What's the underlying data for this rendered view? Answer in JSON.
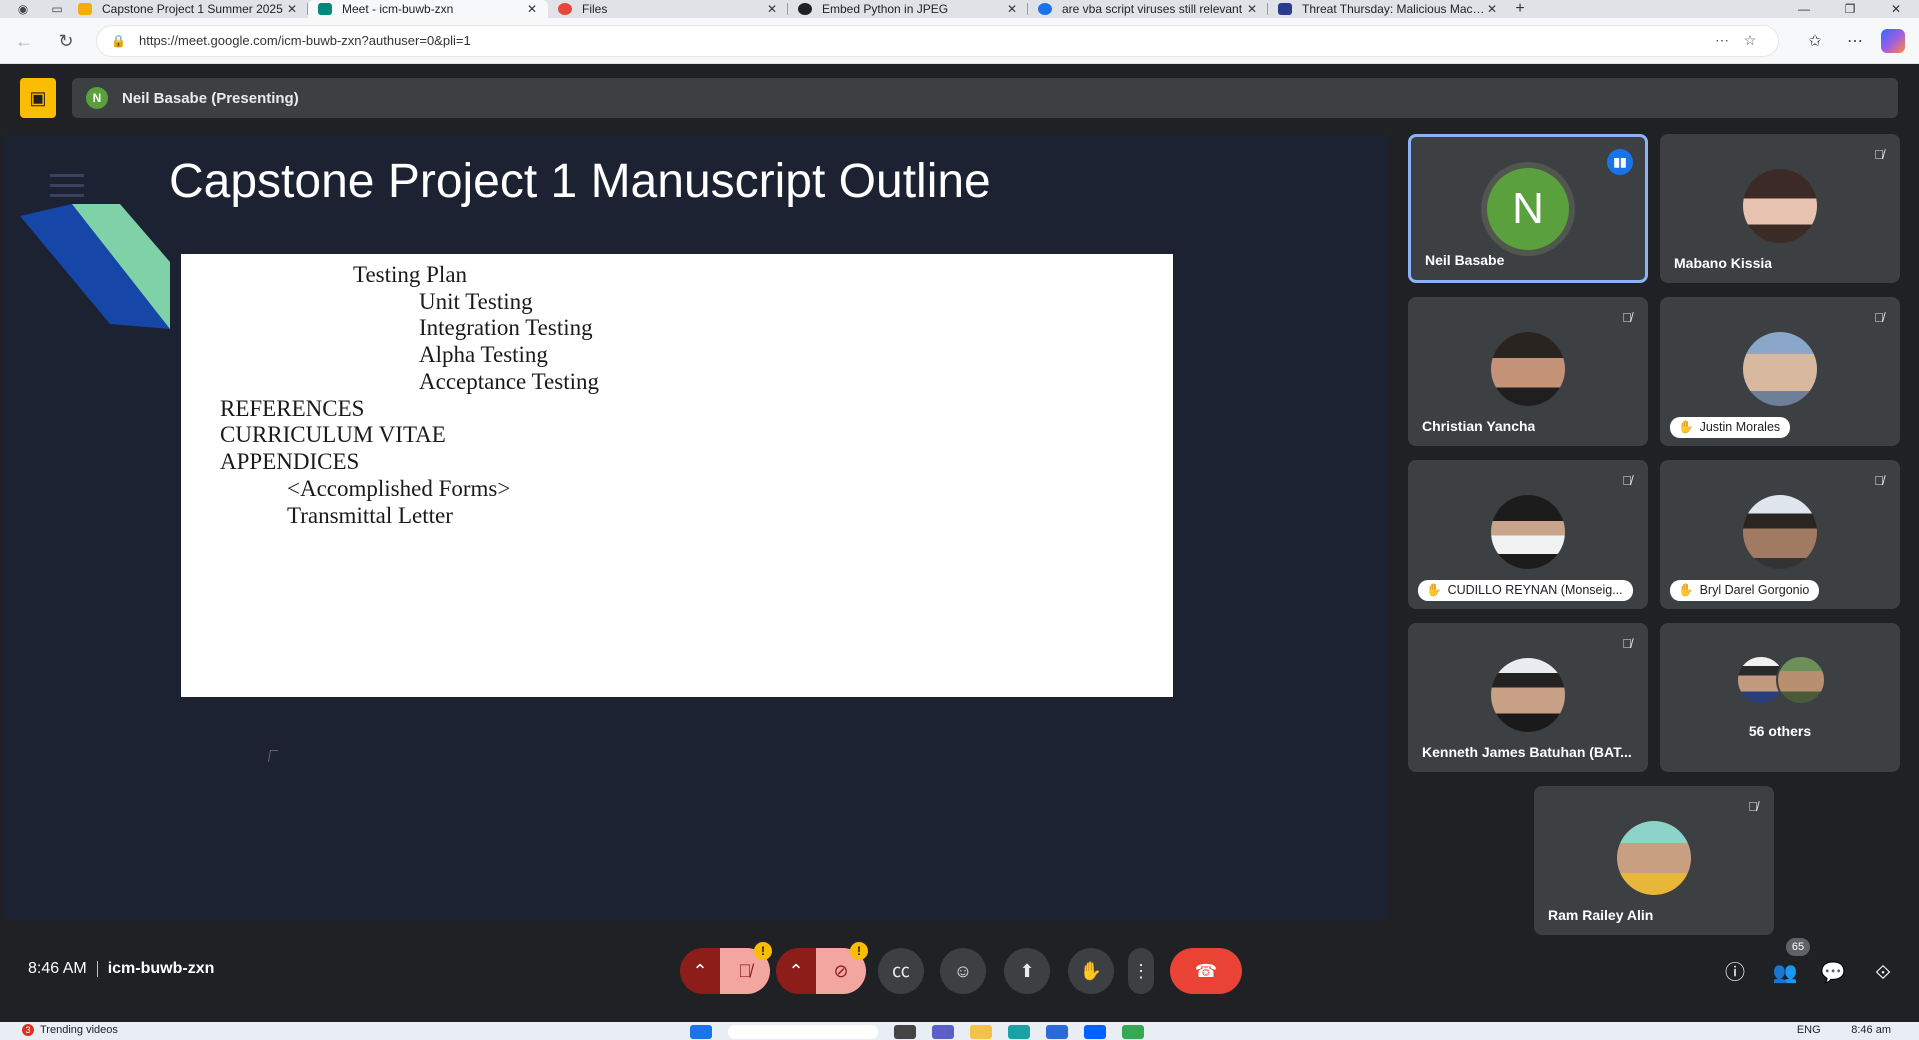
{
  "browser": {
    "tabs": [
      {
        "title": "Capstone Project 1 Summer 2025",
        "active": false,
        "favicon_color": "#f9ab00"
      },
      {
        "title": "Meet - icm-buwb-zxn",
        "active": true,
        "favicon_color": "#00897b"
      },
      {
        "title": "Files",
        "active": false,
        "favicon_color": "#e8453c"
      },
      {
        "title": "Embed Python in JPEG",
        "active": false,
        "favicon_color": "#202124"
      },
      {
        "title": "are vba script viruses still relevant",
        "active": false,
        "favicon_color": "#1a73e8"
      },
      {
        "title": "Threat Thursday: Malicious Macros",
        "active": false,
        "favicon_color": "#2a3a8c"
      }
    ],
    "url": "https://meet.google.com/icm-buwb-zxn?authuser=0&pli=1"
  },
  "presenter": {
    "initial": "N",
    "label": "Neil Basabe (Presenting)"
  },
  "slide": {
    "title": "Capstone Project 1 Manuscript Outline",
    "lines": [
      "Testing Plan",
      "Unit Testing",
      "Integration Testing",
      "Alpha Testing",
      "Acceptance Testing",
      "REFERENCES",
      "CURRICULUM VITAE",
      "APPENDICES",
      "<Accomplished Forms>",
      "Transmittal Letter"
    ]
  },
  "participants": [
    {
      "name": "Neil Basabe",
      "initial": "N",
      "speaking": true,
      "hand_raised": false
    },
    {
      "name": "Mabano Kissia",
      "muted": true,
      "hand_raised": false
    },
    {
      "name": "Christian Yancha",
      "muted": true,
      "hand_raised": false
    },
    {
      "name": "Justin Morales",
      "muted": true,
      "hand_raised": true
    },
    {
      "name": "CUDILLO REYNAN (Monseig...",
      "muted": true,
      "hand_raised": true
    },
    {
      "name": "Bryl Darel Gorgonio",
      "muted": true,
      "hand_raised": true
    },
    {
      "name": "Kenneth James Batuhan (BAT...",
      "muted": true,
      "hand_raised": false
    },
    {
      "name": "56 others"
    },
    {
      "name": "Ram Railey Alin",
      "muted": true,
      "hand_raised": false
    }
  ],
  "controls": {
    "time": "8:46 AM",
    "meeting_code": "icm-buwb-zxn",
    "people_count": "65",
    "warning_symbol": "!"
  },
  "taskbar": {
    "widget_count": "3",
    "widget_label": "Trending videos",
    "language": "ENG",
    "time": "8:46 am"
  },
  "colors": {
    "meet_bg": "#202124",
    "tile_bg": "#3c4043",
    "speaking_border": "#8ab4f8",
    "end_call": "#ea4335",
    "presenting_accent": "#fbbc04"
  }
}
